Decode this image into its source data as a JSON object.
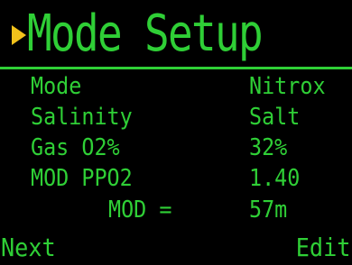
{
  "screen": {
    "title": "Mode Setup",
    "cursor_icon": "right-triangle-icon",
    "colors": {
      "text": "#2fcf36",
      "cursor": "#f2c21b",
      "background": "#000000"
    }
  },
  "settings": [
    {
      "label": "Mode",
      "value": "Nitrox"
    },
    {
      "label": "Salinity",
      "value": "Salt"
    },
    {
      "label": "Gas O2%",
      "value": "32%"
    },
    {
      "label": "MOD PPO2",
      "value": "1.40"
    },
    {
      "label": "MOD =",
      "value": "57m"
    }
  ],
  "softkeys": {
    "left": "Next",
    "right": "Edit"
  }
}
